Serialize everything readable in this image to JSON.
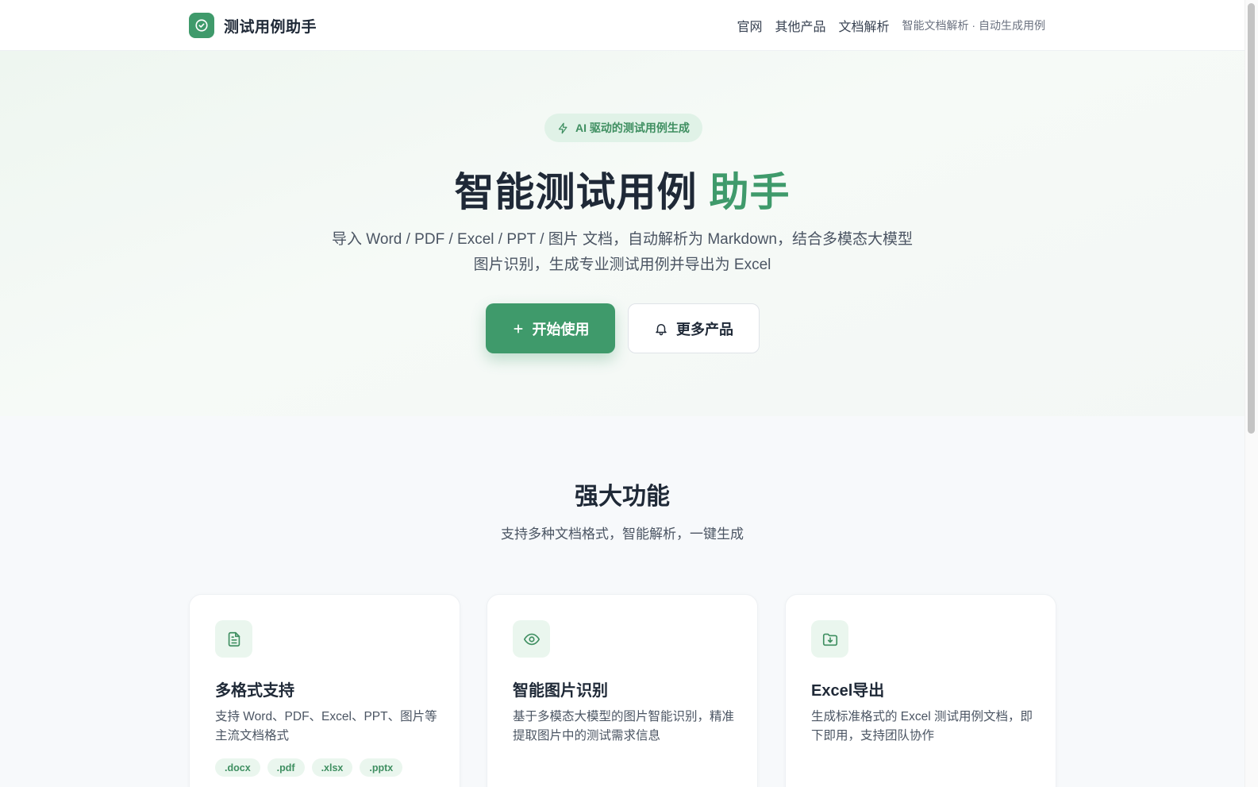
{
  "header": {
    "brand": "测试用例助手",
    "nav": [
      "官网",
      "其他产品",
      "文档解析"
    ],
    "tagline": "智能文档解析 · 自动生成用例"
  },
  "hero": {
    "badge": "AI 驱动的测试用例生成",
    "title_main": "智能测试用例",
    "title_accent": "助手",
    "desc_line1": "导入 Word / PDF / Excel / PPT / 图片 文档，自动解析为 Markdown，结合多模态大模型",
    "desc_line2": "图片识别，生成专业测试用例并导出为 Excel",
    "primary_button": "开始使用",
    "secondary_button": "更多产品"
  },
  "features": {
    "title": "强大功能",
    "subtitle": "支持多种文档格式，智能解析，一键生成",
    "cards": [
      {
        "title": "多格式支持",
        "desc": "支持 Word、PDF、Excel、PPT、图片等主流文档格式",
        "icon": "document-icon",
        "chips": [
          ".docx",
          ".pdf",
          ".xlsx",
          ".pptx"
        ]
      },
      {
        "title": "智能图片识别",
        "desc": "基于多模态大模型的图片智能识别，精准提取图片中的测试需求信息",
        "icon": "eye-icon"
      },
      {
        "title": "Excel导出",
        "desc": "生成标准格式的 Excel 测试用例文档，即下即用，支持团队协作",
        "icon": "folder-download-icon"
      }
    ]
  },
  "colors": {
    "accent": "#3f9a6b",
    "accent_light": "#eaf6ee",
    "text": "#1f2937"
  }
}
